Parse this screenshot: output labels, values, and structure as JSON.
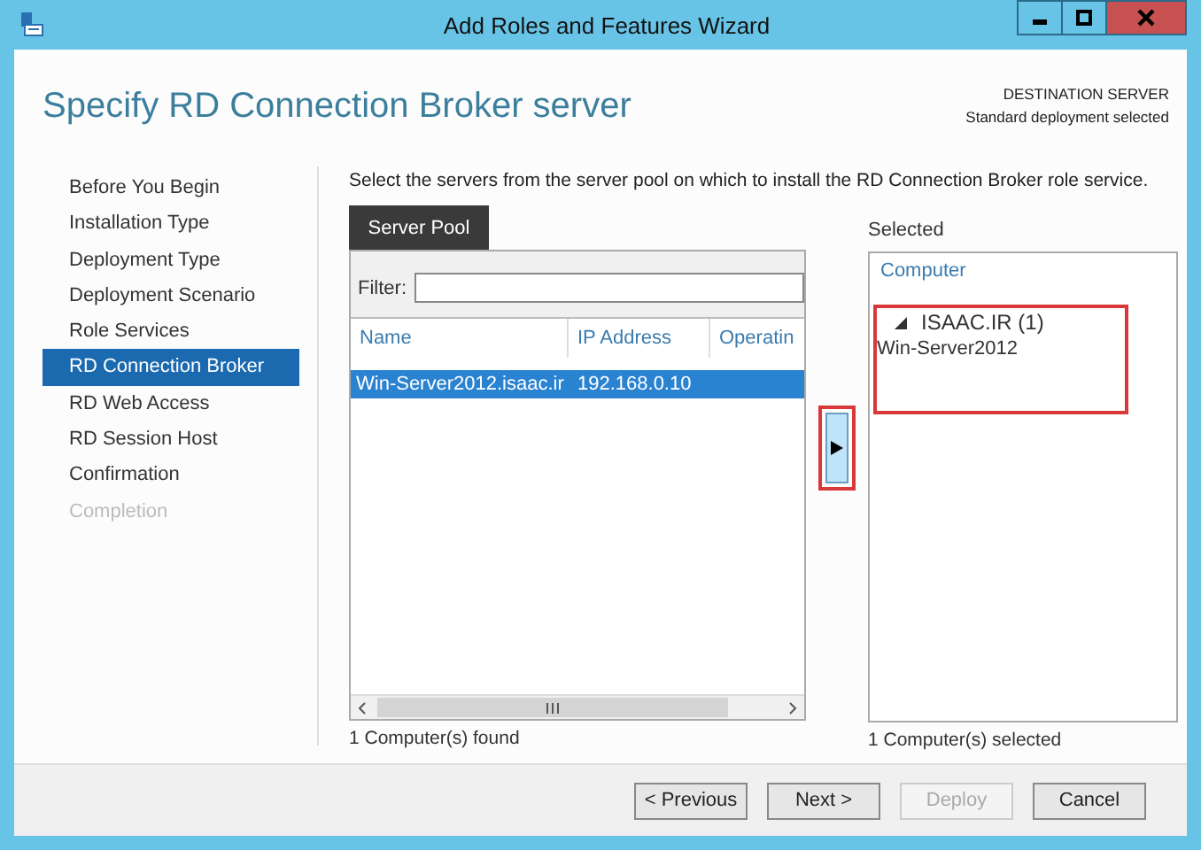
{
  "window": {
    "title": "Add Roles and Features Wizard"
  },
  "header": {
    "title": "Specify RD Connection Broker server",
    "destination_label": "DESTINATION SERVER",
    "destination_value": "Standard deployment selected"
  },
  "steps": [
    {
      "label": "Before You Begin",
      "selected": false,
      "disabled": false
    },
    {
      "label": "Installation Type",
      "selected": false,
      "disabled": false
    },
    {
      "label": "Deployment Type",
      "selected": false,
      "disabled": false
    },
    {
      "label": "Deployment Scenario",
      "selected": false,
      "disabled": false
    },
    {
      "label": "Role Services",
      "selected": false,
      "disabled": false
    },
    {
      "label": "RD Connection Broker",
      "selected": true,
      "disabled": false
    },
    {
      "label": "RD Web Access",
      "selected": false,
      "disabled": false
    },
    {
      "label": "RD Session Host",
      "selected": false,
      "disabled": false
    },
    {
      "label": "Confirmation",
      "selected": false,
      "disabled": false
    },
    {
      "label": "Completion",
      "selected": false,
      "disabled": true
    }
  ],
  "instruction": "Select the servers from the server pool on which to install the RD Connection Broker role service.",
  "pool": {
    "tab": "Server Pool",
    "filter_label": "Filter:",
    "columns": [
      "Name",
      "IP Address",
      "Operatin"
    ],
    "rows": [
      {
        "cells": [
          "Win-Server2012.isaac.ir",
          "192.168.0.10"
        ],
        "selected": true
      }
    ],
    "status": "1 Computer(s) found"
  },
  "selected_list": {
    "label": "Selected",
    "column": "Computer",
    "groups": [
      {
        "label": "ISAAC.IR (1)",
        "expanded": true,
        "children": [
          {
            "label": "Win-Server2012"
          }
        ]
      }
    ],
    "status": "1 Computer(s) selected"
  },
  "buttons": [
    {
      "label": "< Previous",
      "disabled": false
    },
    {
      "label": "Next >",
      "disabled": false
    },
    {
      "label": "Deploy",
      "disabled": true
    },
    {
      "label": "Cancel",
      "disabled": false
    }
  ]
}
